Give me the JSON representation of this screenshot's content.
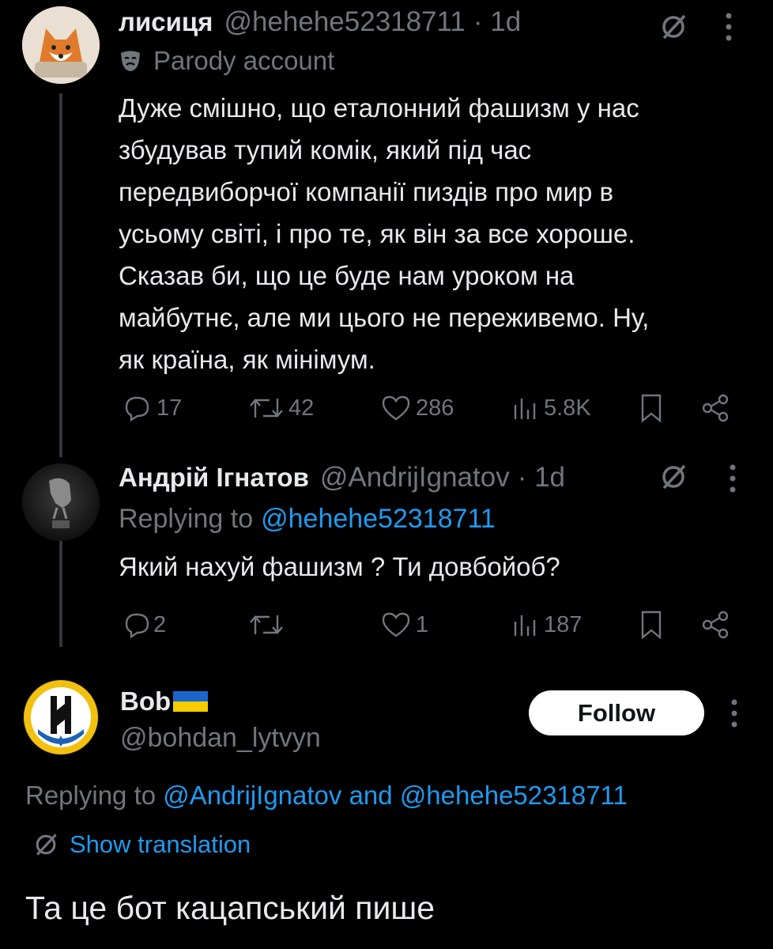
{
  "tweet1": {
    "name": "лисиця",
    "handle": "@hehehe52318711",
    "time": "· 1d",
    "parody_label": "Parody account",
    "lines": [
      "Дуже смішно, що еталонний фашизм у нас",
      "збудував тупий комік, який під час",
      "передвиборчої компанії пиздів про мир в",
      "усьому світі, і про те, як він за все хороше.",
      "Сказав би, що це буде нам уроком на",
      "майбутнє, але ми цього не переживемо. Ну,",
      "як країна, як мінімум."
    ],
    "replies": "17",
    "reposts": "42",
    "likes": "286",
    "views": "5.8K"
  },
  "tweet2": {
    "name": "Андрій Ігнатов",
    "handle": "@AndrijIgnatov",
    "time": "· 1d",
    "replying_prefix": "Replying to",
    "replying_to": "@hehehe52318711",
    "text": "Який нахуй фашизм ? Ти довбойоб?",
    "replies": "2",
    "reposts": "",
    "likes": "1",
    "views": "187"
  },
  "main": {
    "name": "Bob",
    "handle": "@bohdan_lytvyn",
    "follow_label": "Follow",
    "replying_prefix": "Replying to",
    "mention1": "@AndrijIgnatov",
    "and_word": "and",
    "mention2": "@hehehe52318711",
    "translate_label": "Show translation",
    "text": "Та це бот кацапський пише"
  },
  "colors": {
    "background": "#000000",
    "text": "#e7e9ea",
    "muted": "#71767b",
    "link": "#1d9bf0"
  }
}
